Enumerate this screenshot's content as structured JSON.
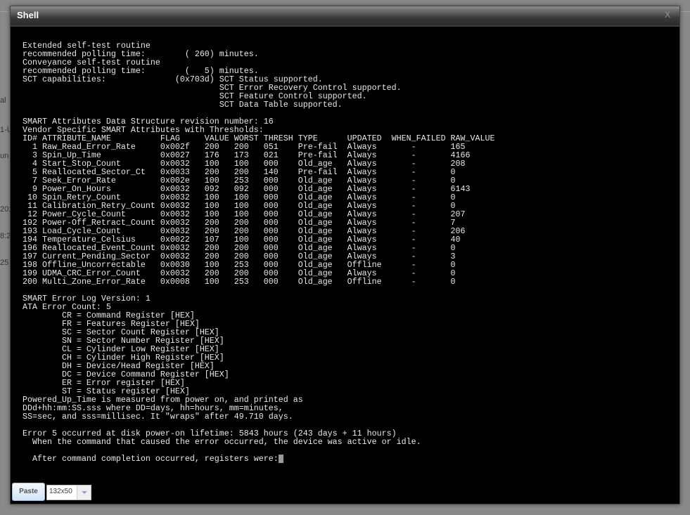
{
  "background": {
    "fragments": [
      "al",
      "1-U",
      "un",
      "201",
      "8:2",
      "25"
    ]
  },
  "dialog": {
    "title": "Shell",
    "close_label": "X"
  },
  "terminal": {
    "lines": [
      "Extended self-test routine",
      "recommended polling time:        ( 260) minutes.",
      "Conveyance self-test routine",
      "recommended polling time:        (   5) minutes.",
      "SCT capabilities:              (0x703d) SCT Status supported.",
      "                                        SCT Error Recovery Control supported.",
      "                                        SCT Feature Control supported.",
      "                                        SCT Data Table supported.",
      "",
      "SMART Attributes Data Structure revision number: 16",
      "Vendor Specific SMART Attributes with Thresholds:",
      "ID# ATTRIBUTE_NAME          FLAG     VALUE WORST THRESH TYPE      UPDATED  WHEN_FAILED RAW_VALUE",
      "  1 Raw_Read_Error_Rate     0x002f   200   200   051    Pre-fail  Always       -       165",
      "  3 Spin_Up_Time            0x0027   176   173   021    Pre-fail  Always       -       4166",
      "  4 Start_Stop_Count        0x0032   100   100   000    Old_age   Always       -       208",
      "  5 Reallocated_Sector_Ct   0x0033   200   200   140    Pre-fail  Always       -       0",
      "  7 Seek_Error_Rate         0x002e   100   253   000    Old_age   Always       -       0",
      "  9 Power_On_Hours          0x0032   092   092   000    Old_age   Always       -       6143",
      " 10 Spin_Retry_Count        0x0032   100   100   000    Old_age   Always       -       0",
      " 11 Calibration_Retry_Count 0x0032   100   100   000    Old_age   Always       -       0",
      " 12 Power_Cycle_Count       0x0032   100   100   000    Old_age   Always       -       207",
      "192 Power-Off_Retract_Count 0x0032   200   200   000    Old_age   Always       -       7",
      "193 Load_Cycle_Count        0x0032   200   200   000    Old_age   Always       -       206",
      "194 Temperature_Celsius     0x0022   107   100   000    Old_age   Always       -       40",
      "196 Reallocated_Event_Count 0x0032   200   200   000    Old_age   Always       -       0",
      "197 Current_Pending_Sector  0x0032   200   200   000    Old_age   Always       -       3",
      "198 Offline_Uncorrectable   0x0030   100   253   000    Old_age   Offline      -       0",
      "199 UDMA_CRC_Error_Count    0x0032   200   200   000    Old_age   Always       -       0",
      "200 Multi_Zone_Error_Rate   0x0008   100   253   000    Old_age   Offline      -       0",
      "",
      "SMART Error Log Version: 1",
      "ATA Error Count: 5",
      "        CR = Command Register [HEX]",
      "        FR = Features Register [HEX]",
      "        SC = Sector Count Register [HEX]",
      "        SN = Sector Number Register [HEX]",
      "        CL = Cylinder Low Register [HEX]",
      "        CH = Cylinder High Register [HEX]",
      "        DH = Device/Head Register [HEX]",
      "        DC = Device Command Register [HEX]",
      "        ER = Error register [HEX]",
      "        ST = Status register [HEX]",
      "Powered_Up_Time is measured from power on, and printed as",
      "DDd+hh:mm:SS.sss where DD=days, hh=hours, mm=minutes,",
      "SS=sec, and sss=millisec. It \"wraps\" after 49.710 days.",
      "",
      "Error 5 occurred at disk power-on lifetime: 5843 hours (243 days + 11 hours)",
      "  When the command that caused the error occurred, the device was active or idle.",
      "",
      "  After command completion occurred, registers were:"
    ]
  },
  "footer": {
    "paste_label": "Paste",
    "size_value": "132x50"
  }
}
